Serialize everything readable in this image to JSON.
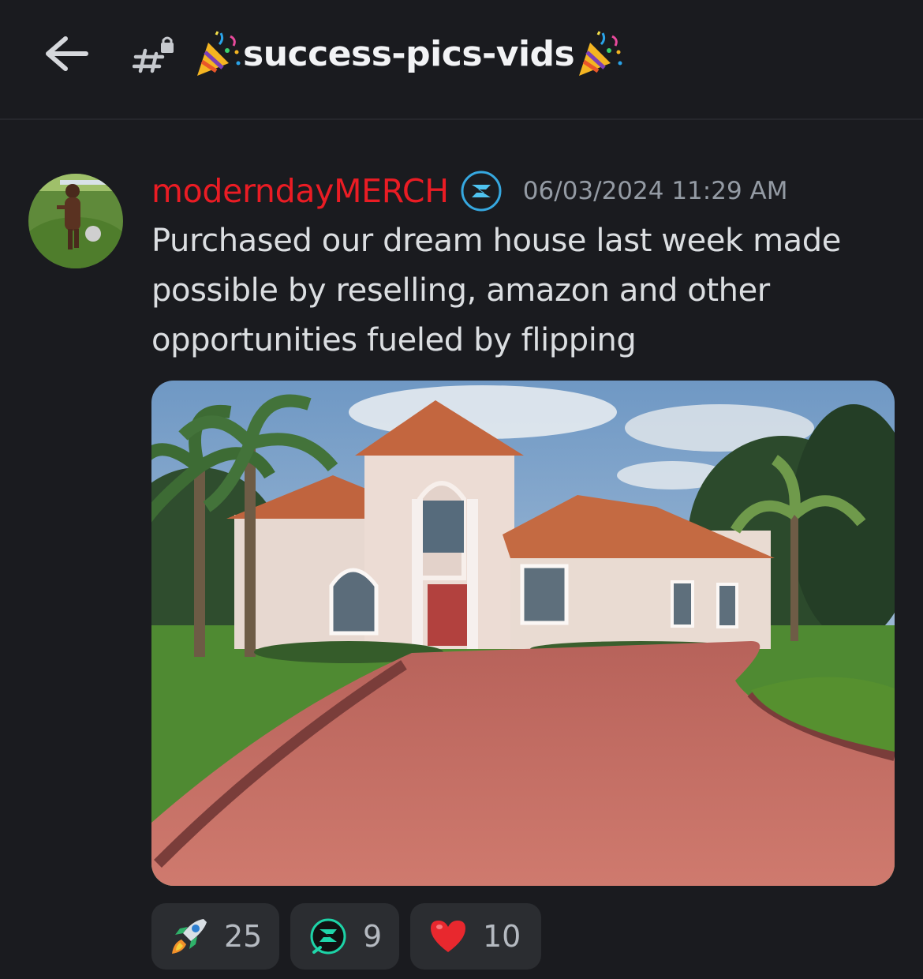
{
  "header": {
    "channel_name": "success-pics-vids",
    "back_icon": "arrow-left-icon",
    "channel_icon": "locked-text-channel-icon",
    "leading_emoji": "party-popper-icon",
    "trailing_emoji": "party-popper-icon"
  },
  "message": {
    "author": "moderndayMERCH",
    "author_color": "#ea1c24",
    "role_icon": "role-badge-icon",
    "timestamp": "06/03/2024 11:29 AM",
    "text": "Purchased our dream house last week made possible by reselling, amazon and other opportunities fueled by flipping",
    "attachment": "house-photo"
  },
  "reactions": [
    {
      "icon": "rocket-icon",
      "count": "25"
    },
    {
      "icon": "server-emoji-icon",
      "count": "9"
    },
    {
      "icon": "red-heart-icon",
      "count": "10"
    }
  ]
}
